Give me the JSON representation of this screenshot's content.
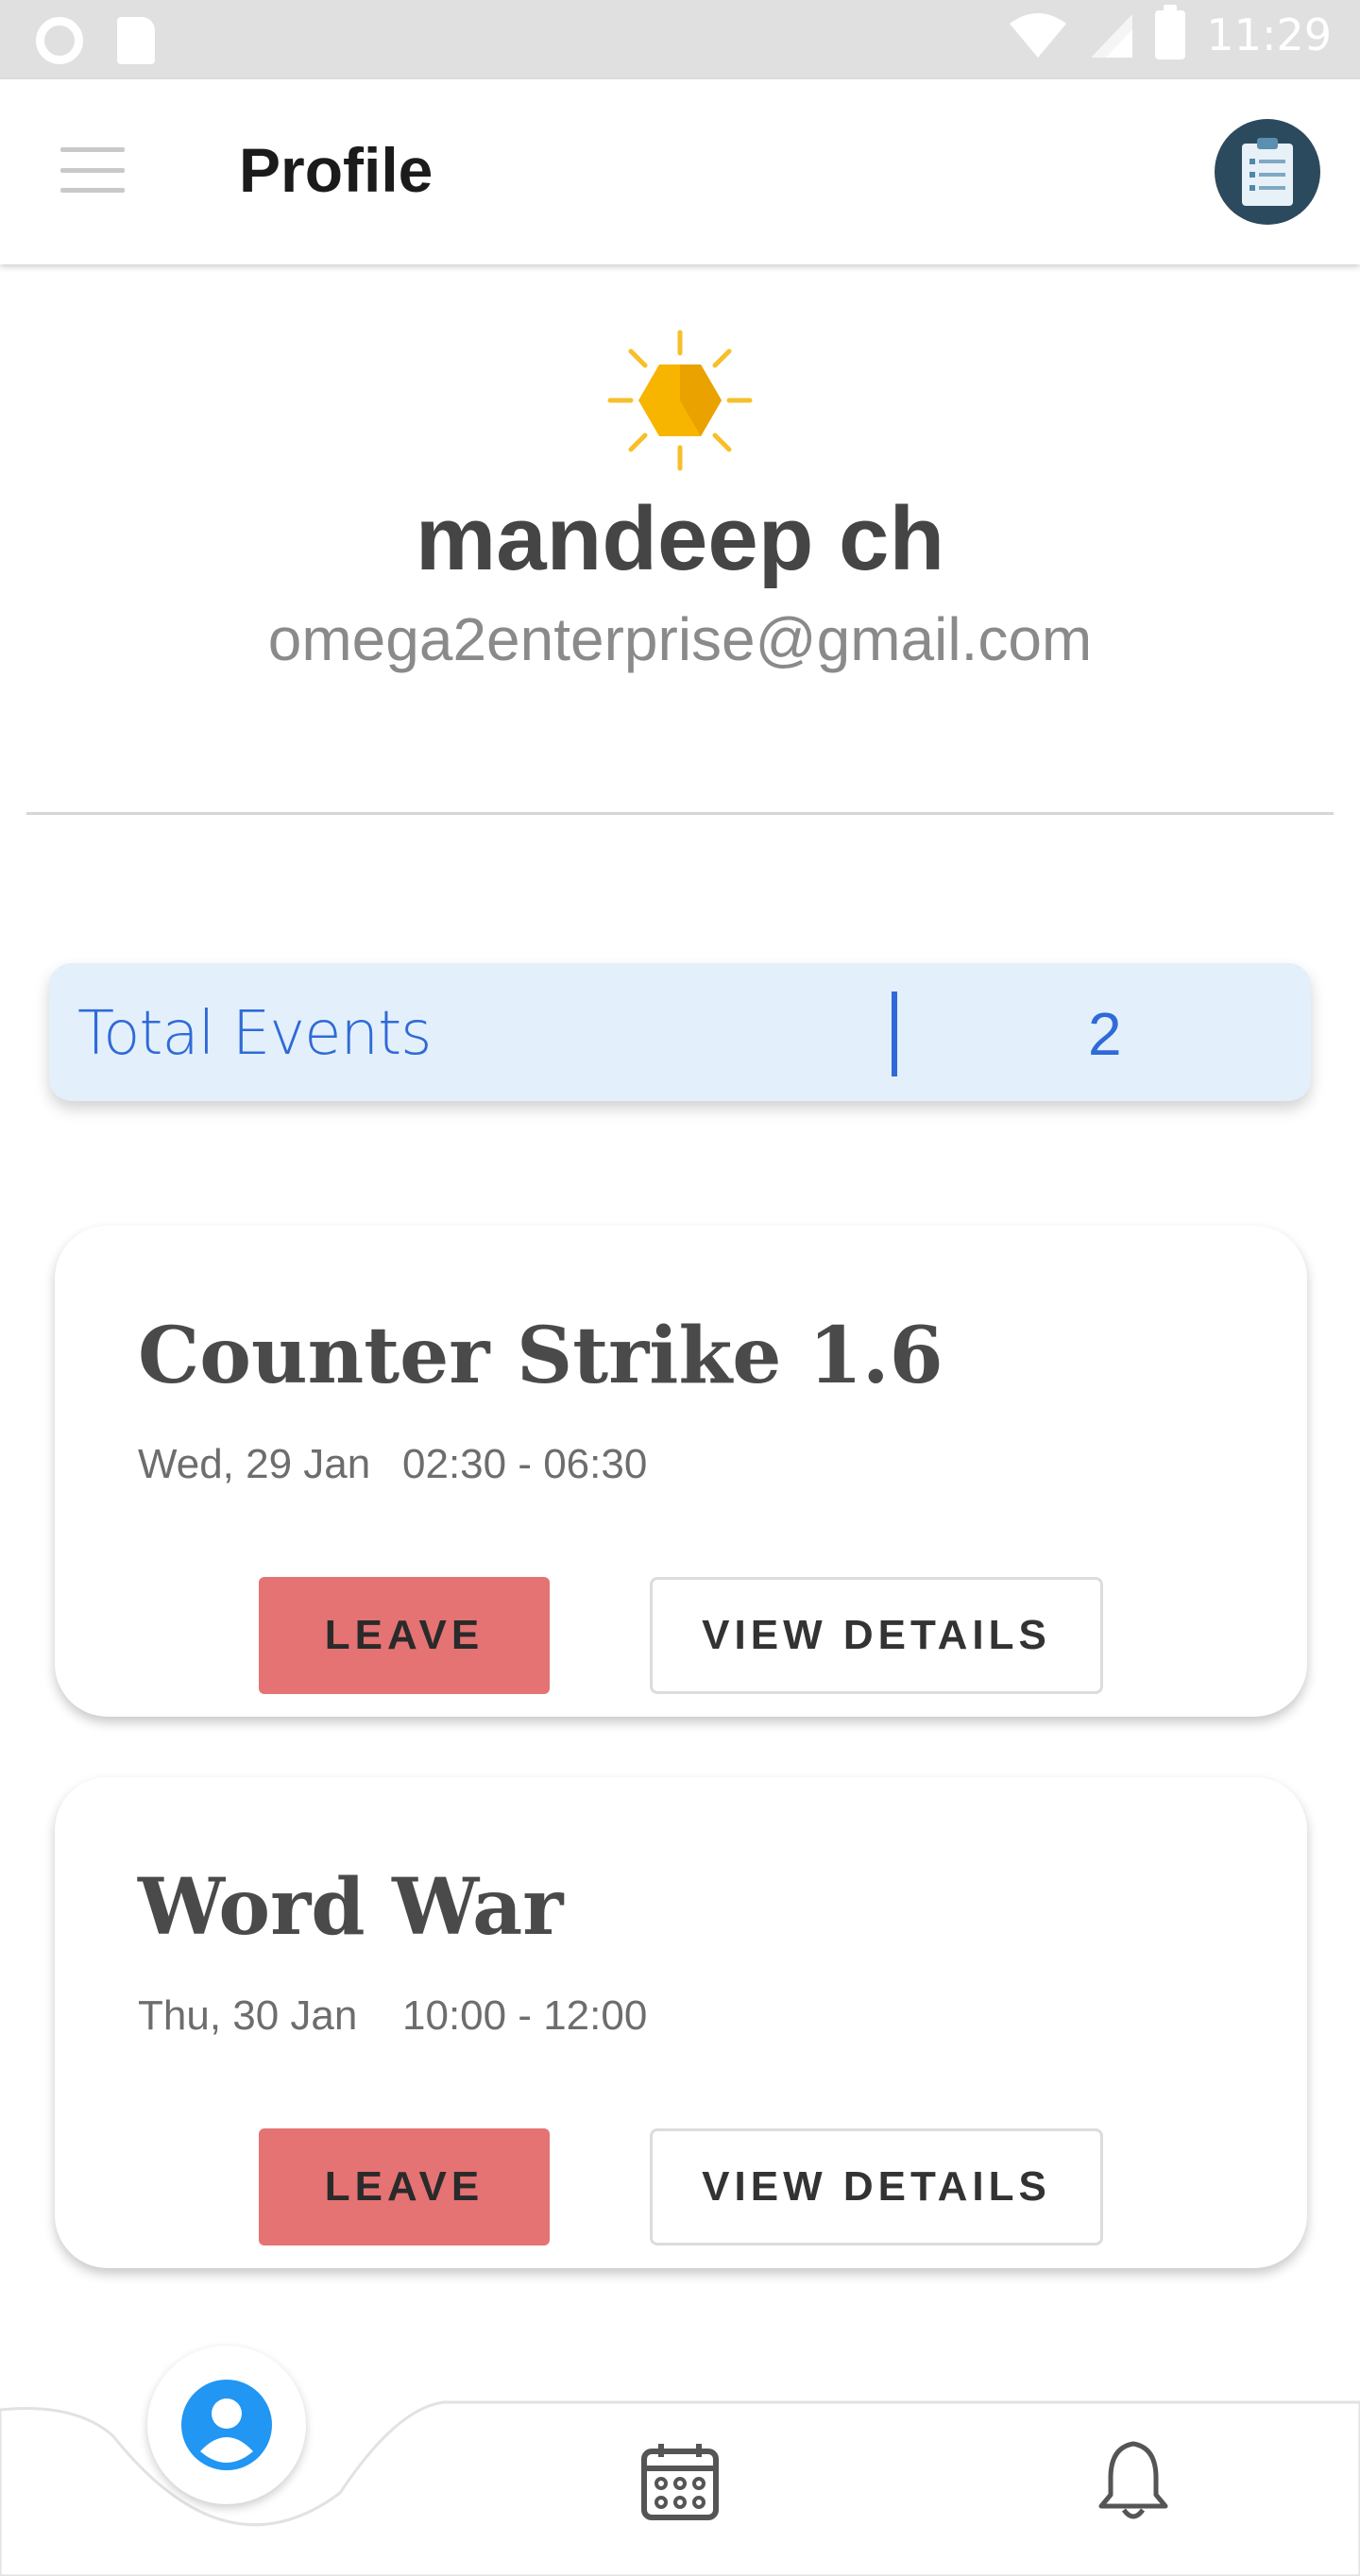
{
  "status_bar": {
    "time": "11:29",
    "icons": [
      "circle-icon",
      "sd-card-icon",
      "wifi-icon",
      "signal-icon",
      "battery-icon"
    ]
  },
  "app_bar": {
    "title": "Profile",
    "icons": [
      "hamburger-menu-icon",
      "clipboard-icon"
    ]
  },
  "profile": {
    "name": "mandeep ch",
    "email": "omega2enterprise@gmail.com",
    "icon": "sun-hexagon-icon"
  },
  "summary": {
    "label": "Total Events",
    "value": "2"
  },
  "events": [
    {
      "title": "Counter Strike 1.6",
      "date": "Wed, 29 Jan",
      "time": "02:30 - 06:30",
      "leave_label": "LEAVE",
      "details_label": "VIEW DETAILS"
    },
    {
      "title": "Word War",
      "date": "Thu, 30 Jan",
      "time": "10:00 - 12:00",
      "leave_label": "LEAVE",
      "details_label": "VIEW DETAILS"
    }
  ],
  "bottom_nav": {
    "items": [
      "profile-icon",
      "calendar-icon",
      "bell-icon"
    ],
    "active": "profile-icon"
  },
  "colors": {
    "accent_blue": "#2f6ad8",
    "summary_bg": "#e3f0fb",
    "leave_red": "#e57373",
    "status_bar": "#e0e0e0"
  }
}
